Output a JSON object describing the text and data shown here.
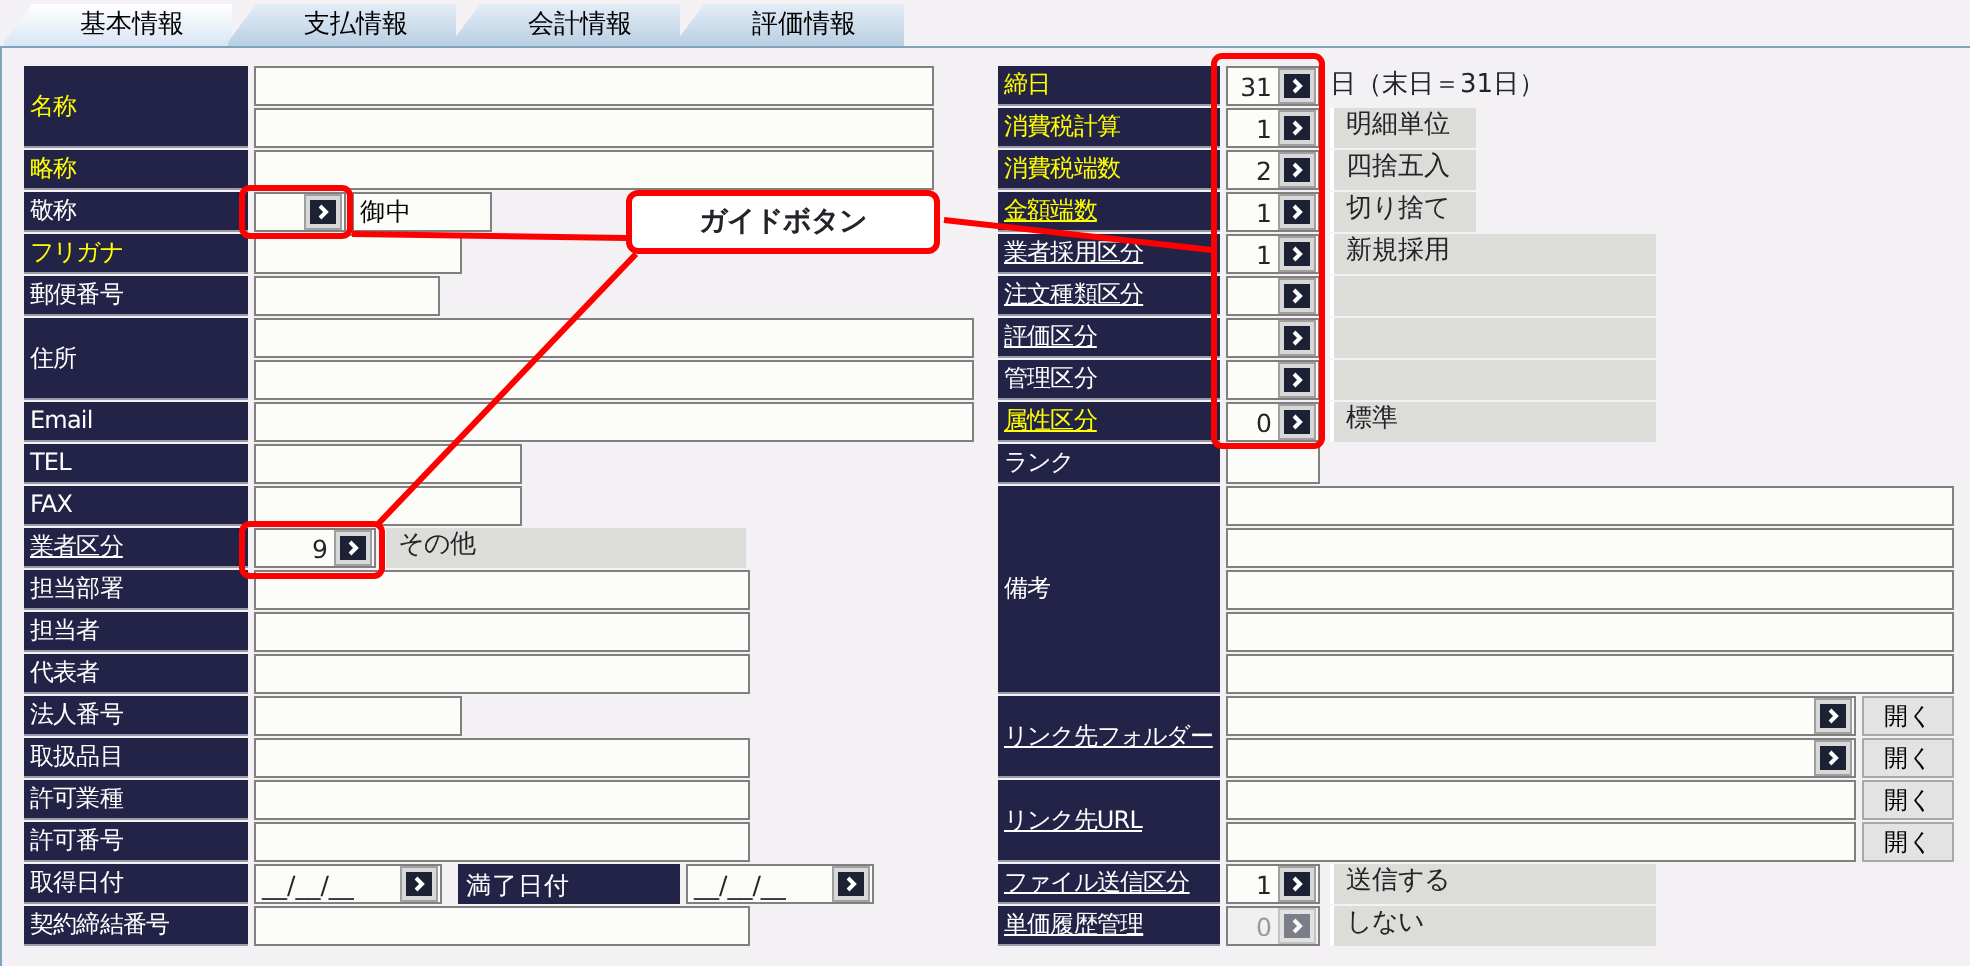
{
  "tabs": [
    {
      "label": "基本情報",
      "selected": true
    },
    {
      "label": "支払情報",
      "selected": false
    },
    {
      "label": "会計情報",
      "selected": false
    },
    {
      "label": "評価情報",
      "selected": false
    }
  ],
  "left_rows": [
    {
      "label": "名称",
      "kind": "text-2",
      "required": true,
      "link": false
    },
    {
      "label": "略称",
      "kind": "text",
      "required": true,
      "link": false
    },
    {
      "label": "敬称",
      "kind": "code",
      "required": false,
      "link": false,
      "disabled": false,
      "description": {
        "kind": "field",
        "text": "御中"
      }
    },
    {
      "label": "フリガナ",
      "kind": "text",
      "required": true,
      "link": false
    },
    {
      "label": "郵便番号",
      "kind": "text",
      "required": false,
      "link": false
    },
    {
      "label": "住所",
      "kind": "text-2",
      "required": false,
      "link": false
    },
    {
      "label": "Email",
      "kind": "text",
      "required": false,
      "link": false
    },
    {
      "label": "TEL",
      "kind": "text",
      "required": false,
      "link": false
    },
    {
      "label": "FAX",
      "kind": "text",
      "required": false,
      "link": false
    },
    {
      "label": "業者区分",
      "kind": "code",
      "required": false,
      "link": true,
      "disabled": false,
      "value": "9",
      "description": {
        "kind": "box",
        "text": "その他"
      }
    },
    {
      "label": "担当部署",
      "kind": "text",
      "required": false,
      "link": false
    },
    {
      "label": "担当者",
      "kind": "text",
      "required": false,
      "link": false
    },
    {
      "label": "代表者",
      "kind": "text",
      "required": false,
      "link": false
    },
    {
      "label": "法人番号",
      "kind": "text",
      "required": false,
      "link": false
    },
    {
      "label": "取扱品目",
      "kind": "text",
      "required": false,
      "link": false
    },
    {
      "label": "許可業種",
      "kind": "text",
      "required": false,
      "link": false
    },
    {
      "label": "許可番号",
      "kind": "text",
      "required": false,
      "link": false
    },
    {
      "label": "取得日付",
      "kind": "date-pair",
      "required": false,
      "link": false,
      "value": "__/__/__",
      "second_label": "満了日付",
      "second_value": "__/__/__"
    },
    {
      "label": "契約締結番号",
      "kind": "text",
      "required": false,
      "link": false
    }
  ],
  "right_rows": [
    {
      "label": "締日",
      "kind": "code",
      "required": true,
      "link": false,
      "disabled": false,
      "value": "31",
      "description": {
        "kind": "plain",
        "text": "日（末日＝31日）"
      }
    },
    {
      "label": "消費税計算",
      "kind": "code",
      "required": true,
      "link": false,
      "disabled": false,
      "value": "1",
      "description": {
        "kind": "box",
        "text": "明細単位"
      }
    },
    {
      "label": "消費税端数",
      "kind": "code",
      "required": true,
      "link": false,
      "disabled": false,
      "value": "2",
      "description": {
        "kind": "box",
        "text": "四捨五入"
      }
    },
    {
      "label": "金額端数",
      "kind": "code",
      "required": true,
      "link": true,
      "disabled": false,
      "value": "1",
      "description": {
        "kind": "box",
        "text": "切り捨て"
      }
    },
    {
      "label": "業者採用区分",
      "kind": "code",
      "required": false,
      "link": true,
      "disabled": false,
      "value": "1",
      "description": {
        "kind": "box",
        "text": "新規採用"
      }
    },
    {
      "label": "注文種類区分",
      "kind": "code",
      "required": false,
      "link": true,
      "disabled": false,
      "description": {
        "kind": "box"
      }
    },
    {
      "label": "評価区分",
      "kind": "code",
      "required": false,
      "link": true,
      "disabled": false,
      "description": {
        "kind": "box"
      }
    },
    {
      "label": "管理区分",
      "kind": "code",
      "required": false,
      "link": false,
      "disabled": false,
      "description": {
        "kind": "box"
      }
    },
    {
      "label": "属性区分",
      "kind": "code",
      "required": true,
      "link": true,
      "disabled": false,
      "value": "0",
      "description": {
        "kind": "box",
        "text": "標準"
      }
    },
    {
      "label": "ランク",
      "kind": "text",
      "required": false,
      "link": false
    },
    {
      "label": "備考",
      "kind": "memo",
      "required": false,
      "link": false
    },
    {
      "label": "リンク先フォルダー",
      "kind": "folder",
      "required": false,
      "link": true,
      "buttons": [
        "開く",
        "開く"
      ]
    },
    {
      "label": "リンク先URL",
      "kind": "url",
      "required": false,
      "link": true,
      "buttons": [
        "開く",
        "開く"
      ]
    },
    {
      "label": "ファイル送信区分",
      "kind": "code",
      "required": false,
      "link": true,
      "disabled": false,
      "value": "1",
      "description": {
        "kind": "box",
        "text": "送信する"
      }
    },
    {
      "label": "単価履歴管理",
      "kind": "code",
      "required": false,
      "link": true,
      "disabled": true,
      "value": "0",
      "description": {
        "kind": "box",
        "text": "しない"
      }
    }
  ],
  "annotation": {
    "label": "ガイドボタン"
  }
}
